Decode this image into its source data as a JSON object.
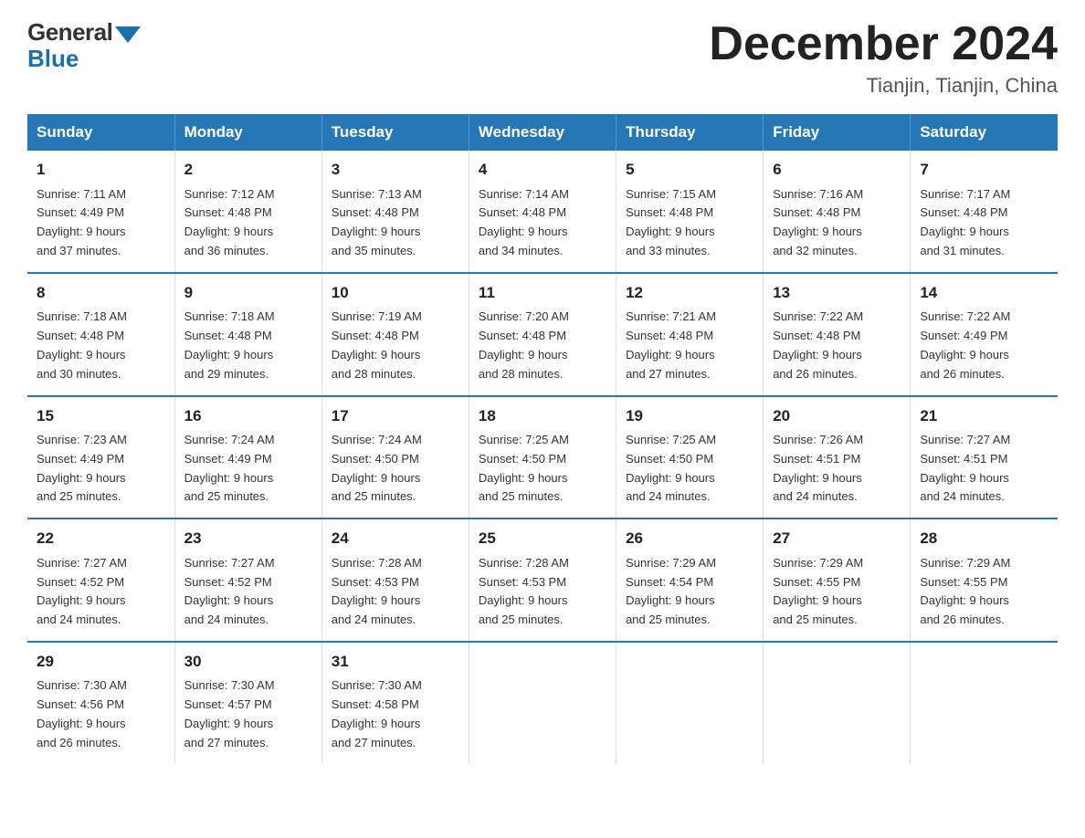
{
  "header": {
    "logo_general": "General",
    "logo_blue": "Blue",
    "month_title": "December 2024",
    "location": "Tianjin, Tianjin, China"
  },
  "days_of_week": [
    "Sunday",
    "Monday",
    "Tuesday",
    "Wednesday",
    "Thursday",
    "Friday",
    "Saturday"
  ],
  "weeks": [
    [
      {
        "day": "1",
        "sunrise": "7:11 AM",
        "sunset": "4:49 PM",
        "daylight": "9 hours and 37 minutes."
      },
      {
        "day": "2",
        "sunrise": "7:12 AM",
        "sunset": "4:48 PM",
        "daylight": "9 hours and 36 minutes."
      },
      {
        "day": "3",
        "sunrise": "7:13 AM",
        "sunset": "4:48 PM",
        "daylight": "9 hours and 35 minutes."
      },
      {
        "day": "4",
        "sunrise": "7:14 AM",
        "sunset": "4:48 PM",
        "daylight": "9 hours and 34 minutes."
      },
      {
        "day": "5",
        "sunrise": "7:15 AM",
        "sunset": "4:48 PM",
        "daylight": "9 hours and 33 minutes."
      },
      {
        "day": "6",
        "sunrise": "7:16 AM",
        "sunset": "4:48 PM",
        "daylight": "9 hours and 32 minutes."
      },
      {
        "day": "7",
        "sunrise": "7:17 AM",
        "sunset": "4:48 PM",
        "daylight": "9 hours and 31 minutes."
      }
    ],
    [
      {
        "day": "8",
        "sunrise": "7:18 AM",
        "sunset": "4:48 PM",
        "daylight": "9 hours and 30 minutes."
      },
      {
        "day": "9",
        "sunrise": "7:18 AM",
        "sunset": "4:48 PM",
        "daylight": "9 hours and 29 minutes."
      },
      {
        "day": "10",
        "sunrise": "7:19 AM",
        "sunset": "4:48 PM",
        "daylight": "9 hours and 28 minutes."
      },
      {
        "day": "11",
        "sunrise": "7:20 AM",
        "sunset": "4:48 PM",
        "daylight": "9 hours and 28 minutes."
      },
      {
        "day": "12",
        "sunrise": "7:21 AM",
        "sunset": "4:48 PM",
        "daylight": "9 hours and 27 minutes."
      },
      {
        "day": "13",
        "sunrise": "7:22 AM",
        "sunset": "4:48 PM",
        "daylight": "9 hours and 26 minutes."
      },
      {
        "day": "14",
        "sunrise": "7:22 AM",
        "sunset": "4:49 PM",
        "daylight": "9 hours and 26 minutes."
      }
    ],
    [
      {
        "day": "15",
        "sunrise": "7:23 AM",
        "sunset": "4:49 PM",
        "daylight": "9 hours and 25 minutes."
      },
      {
        "day": "16",
        "sunrise": "7:24 AM",
        "sunset": "4:49 PM",
        "daylight": "9 hours and 25 minutes."
      },
      {
        "day": "17",
        "sunrise": "7:24 AM",
        "sunset": "4:50 PM",
        "daylight": "9 hours and 25 minutes."
      },
      {
        "day": "18",
        "sunrise": "7:25 AM",
        "sunset": "4:50 PM",
        "daylight": "9 hours and 25 minutes."
      },
      {
        "day": "19",
        "sunrise": "7:25 AM",
        "sunset": "4:50 PM",
        "daylight": "9 hours and 24 minutes."
      },
      {
        "day": "20",
        "sunrise": "7:26 AM",
        "sunset": "4:51 PM",
        "daylight": "9 hours and 24 minutes."
      },
      {
        "day": "21",
        "sunrise": "7:27 AM",
        "sunset": "4:51 PM",
        "daylight": "9 hours and 24 minutes."
      }
    ],
    [
      {
        "day": "22",
        "sunrise": "7:27 AM",
        "sunset": "4:52 PM",
        "daylight": "9 hours and 24 minutes."
      },
      {
        "day": "23",
        "sunrise": "7:27 AM",
        "sunset": "4:52 PM",
        "daylight": "9 hours and 24 minutes."
      },
      {
        "day": "24",
        "sunrise": "7:28 AM",
        "sunset": "4:53 PM",
        "daylight": "9 hours and 24 minutes."
      },
      {
        "day": "25",
        "sunrise": "7:28 AM",
        "sunset": "4:53 PM",
        "daylight": "9 hours and 25 minutes."
      },
      {
        "day": "26",
        "sunrise": "7:29 AM",
        "sunset": "4:54 PM",
        "daylight": "9 hours and 25 minutes."
      },
      {
        "day": "27",
        "sunrise": "7:29 AM",
        "sunset": "4:55 PM",
        "daylight": "9 hours and 25 minutes."
      },
      {
        "day": "28",
        "sunrise": "7:29 AM",
        "sunset": "4:55 PM",
        "daylight": "9 hours and 26 minutes."
      }
    ],
    [
      {
        "day": "29",
        "sunrise": "7:30 AM",
        "sunset": "4:56 PM",
        "daylight": "9 hours and 26 minutes."
      },
      {
        "day": "30",
        "sunrise": "7:30 AM",
        "sunset": "4:57 PM",
        "daylight": "9 hours and 27 minutes."
      },
      {
        "day": "31",
        "sunrise": "7:30 AM",
        "sunset": "4:58 PM",
        "daylight": "9 hours and 27 minutes."
      },
      null,
      null,
      null,
      null
    ]
  ],
  "labels": {
    "sunrise": "Sunrise:",
    "sunset": "Sunset:",
    "daylight": "Daylight:"
  }
}
